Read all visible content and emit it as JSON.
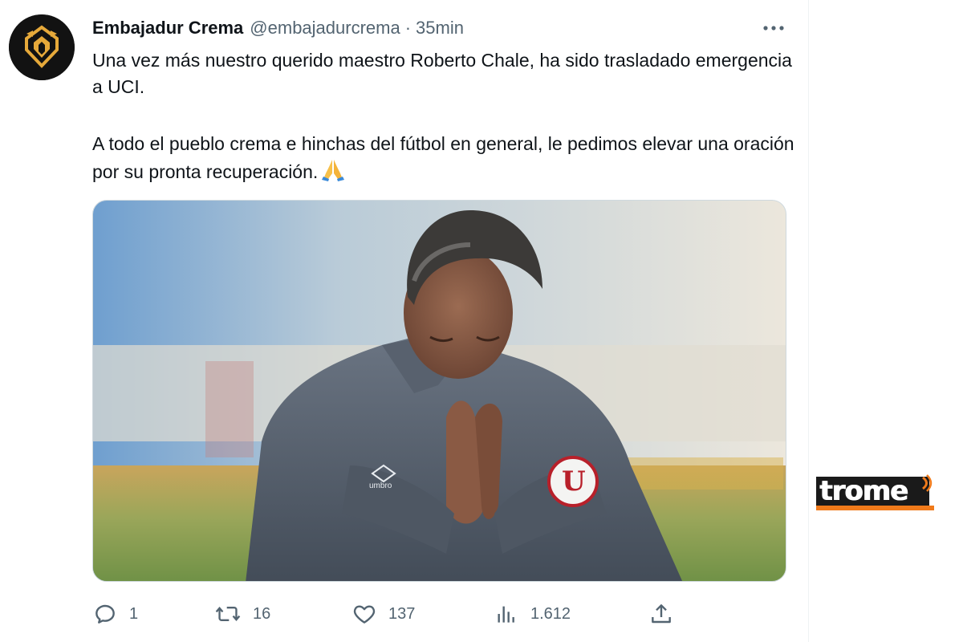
{
  "tweet": {
    "display_name": "Embajadur Crema",
    "handle": "@embajadurcrema",
    "separator": "·",
    "time": "35min",
    "text_p1": "Una vez más nuestro querido maestro Roberto Chale, ha sido trasladado emergencia a UCI.",
    "text_p2": "A todo el pueblo crema e hinchas del fútbol en general, le pedimos elevar una oración por su pronta recuperación.",
    "emoji": "folded-hands-emoji"
  },
  "media": {
    "jacket_brand": "umbro",
    "crest_letter": "U"
  },
  "actions": {
    "replies": "1",
    "retweets": "16",
    "likes": "137",
    "views": "1.612"
  },
  "watermark": {
    "text": "trome"
  },
  "colors": {
    "text_primary": "#0f1419",
    "text_secondary": "#536471",
    "border": "#cfd9de",
    "avatar_bg": "#121212",
    "avatar_accent": "#e6a93a",
    "watermark_orange": "#f07a1a",
    "watermark_dark": "#1a1a1a"
  }
}
